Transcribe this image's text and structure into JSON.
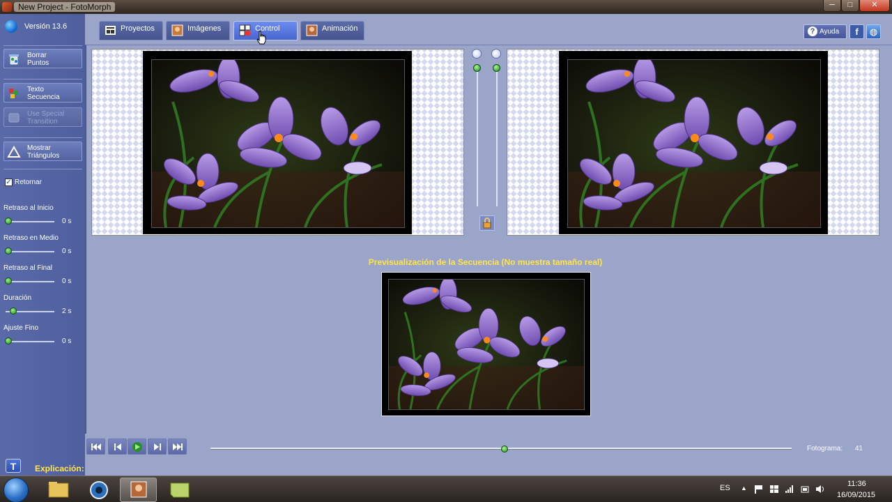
{
  "window": {
    "title": "New Project - FotoMorph",
    "minimize": "─",
    "maximize": "□",
    "close": "✕"
  },
  "sidebar": {
    "version": "Versión 13.6",
    "buttons": [
      {
        "label_line1": "Borrar",
        "label_line2": "Puntos",
        "icon": "erase-points-icon"
      },
      {
        "label_line1": "Texto",
        "label_line2": "Secuencia",
        "icon": "text-sequence-icon"
      },
      {
        "label_line1": "Use Special",
        "label_line2": "Transition",
        "icon": "special-transition-icon"
      },
      {
        "label_line1": "Mostrar",
        "label_line2": "Triángulos",
        "icon": "triangle-icon"
      }
    ],
    "return_checkbox": {
      "label": "Retornar",
      "checked": true,
      "mark": "✓"
    },
    "sliders": [
      {
        "label": "Retraso al Inicio",
        "value": "0 s",
        "fraction": 0.0
      },
      {
        "label": "Retraso en Medio",
        "value": "0 s",
        "fraction": 0.0
      },
      {
        "label": "Retraso al Final",
        "value": "0 s",
        "fraction": 0.0
      },
      {
        "label": "Duración",
        "value": "2 s",
        "fraction": 0.1
      },
      {
        "label": "Ajuste Fino",
        "value": "0 s",
        "fraction": 0.0
      }
    ]
  },
  "tabs": [
    {
      "label": "Proyectos",
      "icon": "projects-icon",
      "active": false
    },
    {
      "label": "Imágenes",
      "icon": "images-icon",
      "active": false
    },
    {
      "label": "Control",
      "icon": "control-icon",
      "active": true
    },
    {
      "label": "Animación",
      "icon": "animation-icon",
      "active": false
    }
  ],
  "header_right": {
    "help": "Ayuda",
    "help_glyph": "?",
    "facebook_glyph": "f",
    "web_glyph": "◍"
  },
  "preview": {
    "label": "Previsualización de la Secuencia (No muestra tamaño real)"
  },
  "controls": {
    "frame_label": "Fotograma:",
    "frame_value": "41",
    "timeline_fraction": 0.5
  },
  "footer": {
    "explain_label": "Explicación:",
    "explain_glyph": "T"
  },
  "taskbar": {
    "lang": "ES",
    "time": "11:36",
    "date": "16/09/2015",
    "tray_chevron": "▲"
  },
  "colors": {
    "accent_yellow": "#ffe54a",
    "sidebar": "#5565a5",
    "content_bg": "#9ba4c9",
    "active_tab": "#5b7be0"
  }
}
